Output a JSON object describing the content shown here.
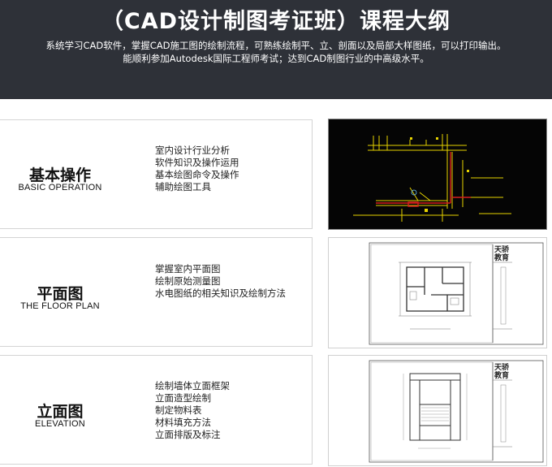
{
  "header": {
    "title": "（CAD设计制图考证班）课程大纲",
    "desc_line1": "系统学习CAD软件，掌握CAD施工图的绘制流程，可熟练绘制平、立、剖面以及局部大样图纸，可以打印输出。",
    "desc_line2": "能顺利参加Autodesk国际工程师考试；达到CAD制图行业的中高级水平。"
  },
  "modules": [
    {
      "title_cn": "基本操作",
      "title_en": "BASIC OPERATION",
      "items": [
        "室内设计行业分析",
        "软件知识及操作运用",
        "基本绘图命令及操作",
        "辅助绘图工具"
      ]
    },
    {
      "title_cn": "平面图",
      "title_en": "THE FLOOR PLAN",
      "items": [
        "掌握室内平面图",
        "绘制原始测量图",
        "水电图纸的相关知识及绘制方法"
      ],
      "stamp": [
        "天骄",
        "教育"
      ]
    },
    {
      "title_cn": "立面图",
      "title_en": "ELEVATION",
      "items": [
        "绘制墙体立面框架",
        "立面造型绘制",
        "制定物料表",
        "材料填充方法",
        "立面排版及标注"
      ],
      "stamp": [
        "天骄",
        "教育"
      ]
    }
  ],
  "colors": {
    "header_bg": "#2e3138",
    "cad_bg": "#050505",
    "cad_yellow": "#e6d200",
    "cad_red": "#d81e1e"
  }
}
